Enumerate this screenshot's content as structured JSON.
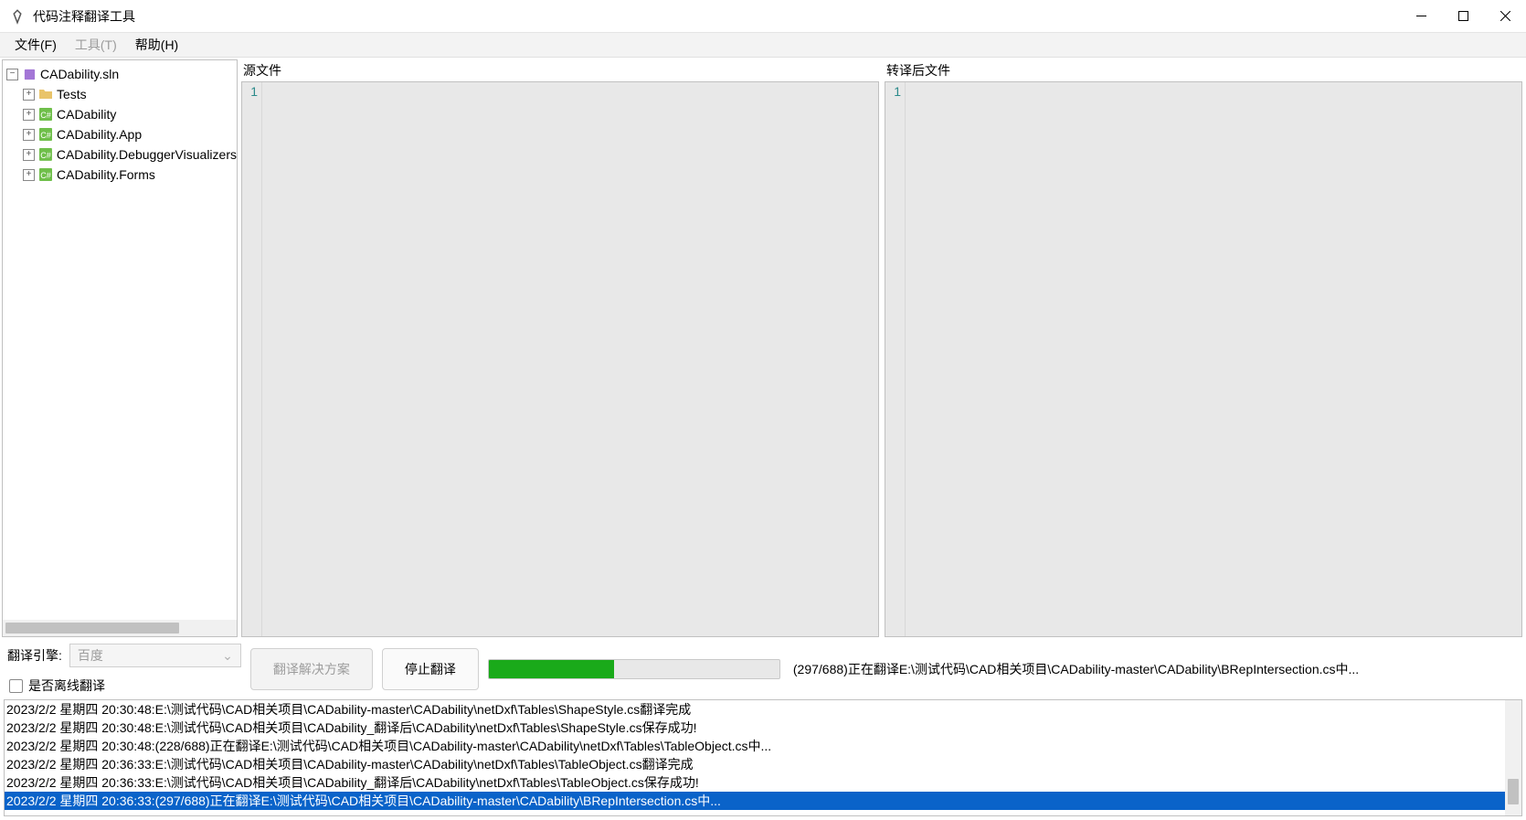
{
  "window": {
    "title": "代码注释翻译工具"
  },
  "menu": {
    "file": "文件(F)",
    "tools": "工具(T)",
    "help": "帮助(H)"
  },
  "tree": {
    "root": "CADability.sln",
    "items": [
      {
        "label": "Tests",
        "kind": "folder"
      },
      {
        "label": "CADability",
        "kind": "cs"
      },
      {
        "label": "CADability.App",
        "kind": "cs"
      },
      {
        "label": "CADability.DebuggerVisualizers",
        "kind": "cs"
      },
      {
        "label": "CADability.Forms",
        "kind": "cs"
      }
    ]
  },
  "editors": {
    "source_label": "源文件",
    "target_label": "转译后文件",
    "source_line": "1",
    "target_line": "1"
  },
  "controls": {
    "engine_label": "翻译引擎:",
    "engine_value": "百度",
    "offline_label": "是否离线翻译",
    "btn_translate": "翻译解决方案",
    "btn_stop": "停止翻译",
    "progress_pct": 43,
    "status": "(297/688)正在翻译E:\\测试代码\\CAD相关项目\\CADability-master\\CADability\\BRepIntersection.cs中..."
  },
  "log": [
    "2023/2/2 星期四 20:30:48:E:\\测试代码\\CAD相关项目\\CADability-master\\CADability\\netDxf\\Tables\\ShapeStyle.cs翻译完成",
    "2023/2/2 星期四 20:30:48:E:\\测试代码\\CAD相关项目\\CADability_翻译后\\CADability\\netDxf\\Tables\\ShapeStyle.cs保存成功!",
    "2023/2/2 星期四 20:30:48:(228/688)正在翻译E:\\测试代码\\CAD相关项目\\CADability-master\\CADability\\netDxf\\Tables\\TableObject.cs中...",
    "2023/2/2 星期四 20:36:33:E:\\测试代码\\CAD相关项目\\CADability-master\\CADability\\netDxf\\Tables\\TableObject.cs翻译完成",
    "2023/2/2 星期四 20:36:33:E:\\测试代码\\CAD相关项目\\CADability_翻译后\\CADability\\netDxf\\Tables\\TableObject.cs保存成功!",
    "2023/2/2 星期四 20:36:33:(297/688)正在翻译E:\\测试代码\\CAD相关项目\\CADability-master\\CADability\\BRepIntersection.cs中..."
  ],
  "log_selected_index": 5
}
